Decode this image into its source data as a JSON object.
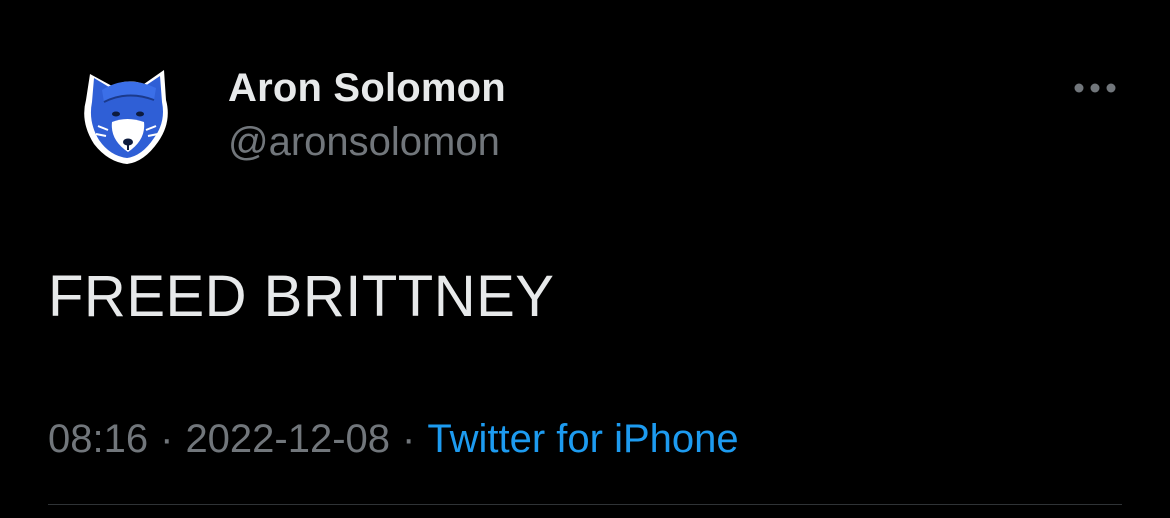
{
  "user": {
    "display_name": "Aron Solomon",
    "handle": "@aronsolomon",
    "avatar_icon": "fox-avatar-icon"
  },
  "more_icon": "more-options-icon",
  "tweet": {
    "text": "FREED BRITTNEY"
  },
  "meta": {
    "time": "08:16",
    "separator": "·",
    "date": "2022-12-08",
    "source": "Twitter for iPhone"
  },
  "colors": {
    "background": "#000000",
    "primary_text": "#e7e9ea",
    "secondary_text": "#71767b",
    "link": "#1d9bf0",
    "divider": "#2f3336",
    "avatar_blue": "#2f5fd6"
  }
}
